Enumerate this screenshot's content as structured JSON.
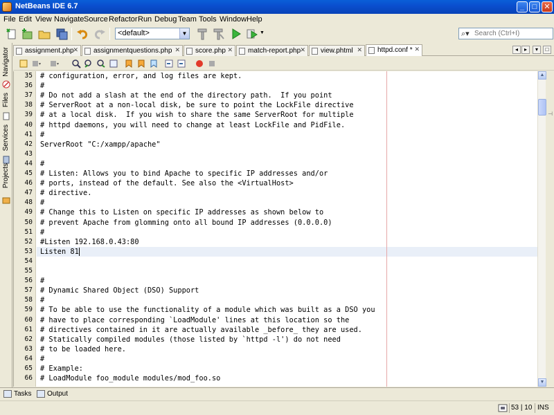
{
  "window": {
    "title": "NetBeans IDE 6.7"
  },
  "menu": [
    "File",
    "Edit",
    "View",
    "Navigate",
    "Source",
    "Refactor",
    "Run",
    "Debug",
    "Team",
    "Tools",
    "Window",
    "Help"
  ],
  "toolbar": {
    "config_value": "<default>",
    "search_placeholder": "Search (Ctrl+I)"
  },
  "sidebar": {
    "tabs": [
      "Navigator",
      "Files",
      "Services",
      "Projects"
    ]
  },
  "tabs": [
    {
      "label": "assignment.php",
      "active": false
    },
    {
      "label": "assignmentquestions.php",
      "active": false
    },
    {
      "label": "score.php",
      "active": false
    },
    {
      "label": "match-report.php",
      "active": false
    },
    {
      "label": "view.phtml",
      "active": false
    },
    {
      "label": "httpd.conf *",
      "active": true
    }
  ],
  "editor": {
    "current_line": 53,
    "lines": [
      {
        "n": "35",
        "text": "# configuration, error, and log files are kept."
      },
      {
        "n": "36",
        "text": "#"
      },
      {
        "n": "37",
        "text": "# Do not add a slash at the end of the directory path.  If you point"
      },
      {
        "n": "38",
        "text": "# ServerRoot at a non-local disk, be sure to point the LockFile directive"
      },
      {
        "n": "39",
        "text": "# at a local disk.  If you wish to share the same ServerRoot for multiple"
      },
      {
        "n": "40",
        "text": "# httpd daemons, you will need to change at least LockFile and PidFile."
      },
      {
        "n": "41",
        "text": "#"
      },
      {
        "n": "42",
        "text": "ServerRoot \"C:/xampp/apache\""
      },
      {
        "n": "43",
        "text": ""
      },
      {
        "n": "44",
        "text": "#"
      },
      {
        "n": "45",
        "text": "# Listen: Allows you to bind Apache to specific IP addresses and/or"
      },
      {
        "n": "46",
        "text": "# ports, instead of the default. See also the <VirtualHost>"
      },
      {
        "n": "47",
        "text": "# directive."
      },
      {
        "n": "48",
        "text": "#"
      },
      {
        "n": "49",
        "text": "# Change this to Listen on specific IP addresses as shown below to"
      },
      {
        "n": "50",
        "text": "# prevent Apache from glomming onto all bound IP addresses (0.0.0.0)"
      },
      {
        "n": "51",
        "text": "#"
      },
      {
        "n": "52",
        "text": "#Listen 192.168.0.43:80"
      },
      {
        "n": "53",
        "text": "Listen 81"
      },
      {
        "n": "54",
        "text": ""
      },
      {
        "n": "55",
        "text": ""
      },
      {
        "n": "56",
        "text": "#"
      },
      {
        "n": "57",
        "text": "# Dynamic Shared Object (DSO) Support"
      },
      {
        "n": "58",
        "text": "#"
      },
      {
        "n": "59",
        "text": "# To be able to use the functionality of a module which was built as a DSO you"
      },
      {
        "n": "60",
        "text": "# have to place corresponding `LoadModule' lines at this location so the"
      },
      {
        "n": "61",
        "text": "# directives contained in it are actually available _before_ they are used."
      },
      {
        "n": "62",
        "text": "# Statically compiled modules (those listed by `httpd -l') do not need"
      },
      {
        "n": "63",
        "text": "# to be loaded here."
      },
      {
        "n": "64",
        "text": "#"
      },
      {
        "n": "65",
        "text": "# Example:"
      },
      {
        "n": "66",
        "text": "# LoadModule foo_module modules/mod_foo.so"
      }
    ]
  },
  "bottom_tabs": [
    "Tasks",
    "Output"
  ],
  "status": {
    "position": "53 | 10",
    "mode": "INS"
  },
  "colors": {
    "title_bar": "#0a4fcf",
    "current_line": "#e9eff8",
    "right_margin": "#e6a7a7"
  }
}
